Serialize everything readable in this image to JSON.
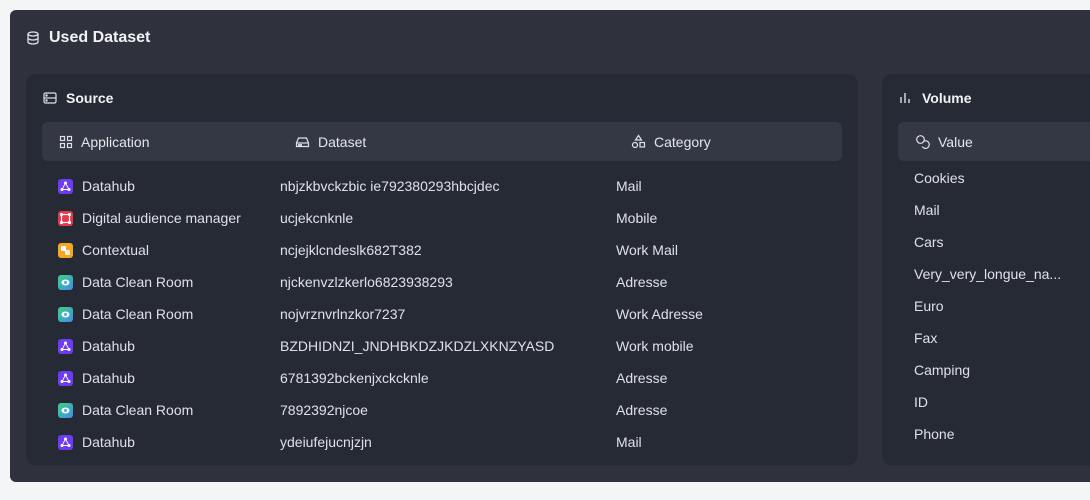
{
  "panel": {
    "title": "Used Dataset",
    "icon": "database-icon"
  },
  "source": {
    "title": "Source",
    "icon": "server-icon",
    "columns": {
      "application": "Application",
      "dataset": "Dataset",
      "category": "Category"
    },
    "rows": [
      {
        "app": "Datahub",
        "app_icon": "datahub-icon",
        "app_color": "#6d3df5",
        "dataset": "nbjzkbvckzbic ie792380293hbcjdec",
        "category": "Mail"
      },
      {
        "app": "Digital audience manager",
        "app_icon": "audience-manager-icon",
        "app_color": "#e8364a",
        "dataset": "ucjekcnknle",
        "category": "Mobile"
      },
      {
        "app": "Contextual",
        "app_icon": "contextual-icon",
        "app_color": "#f5a623",
        "dataset": "ncjejklcndeslk682T382",
        "category": "Work Mail"
      },
      {
        "app": "Data Clean Room",
        "app_icon": "clean-room-icon",
        "app_color": "#3bb2e8",
        "dataset": "njckenvzlzkerlo6823938293",
        "category": "Adresse"
      },
      {
        "app": "Data Clean Room",
        "app_icon": "clean-room-icon",
        "app_color": "#3bb2e8",
        "dataset": "nojvrznvrlnzkor7237",
        "category": "Work Adresse"
      },
      {
        "app": "Datahub",
        "app_icon": "datahub-icon",
        "app_color": "#6d3df5",
        "dataset": "BZDHIDNZI_JNDHBKDZJKDZLXKNZYASD",
        "category": "Work mobile"
      },
      {
        "app": "Datahub",
        "app_icon": "datahub-icon",
        "app_color": "#6d3df5",
        "dataset": "6781392bckenjxckcknle",
        "category": "Adresse"
      },
      {
        "app": "Data Clean Room",
        "app_icon": "clean-room-icon",
        "app_color": "#3bb2e8",
        "dataset": "7892392njcoe",
        "category": "Adresse"
      },
      {
        "app": "Datahub",
        "app_icon": "datahub-icon",
        "app_color": "#6d3df5",
        "dataset": "ydeiufejucnjzjn",
        "category": "Mail"
      }
    ]
  },
  "volume": {
    "title": "Volume",
    "icon": "bar-chart-icon",
    "column": "Value",
    "column_icon": "coins-icon",
    "rows": [
      "Cookies",
      "Mail",
      "Cars",
      "Very_very_longue_na...",
      "Euro",
      "Fax",
      "Camping",
      "ID",
      "Phone"
    ]
  }
}
